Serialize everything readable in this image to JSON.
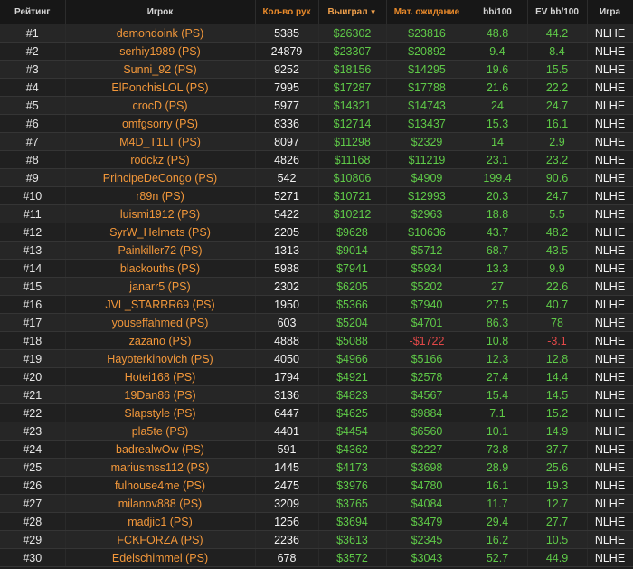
{
  "headers": {
    "rank": "Рейтинг",
    "player": "Игрок",
    "hands": "Кол-во рук",
    "won": "Выиграл",
    "ev": "Мат. ожидание",
    "bb100": "bb/100",
    "evbb100": "EV bb/100",
    "game": "Игра"
  },
  "sort_arrow": "▼",
  "colors": {
    "accent": "#f2973a",
    "positive": "#5fca48",
    "negative": "#e24848",
    "background": "#1e1e1e"
  },
  "rows": [
    {
      "rank": "#1",
      "player": "demondoink (PS)",
      "hands": "5385",
      "won": "$26302",
      "ev": "$23816",
      "bb100": "48.8",
      "evbb100": "44.2",
      "game": "NLHE"
    },
    {
      "rank": "#2",
      "player": "serhiy1989 (PS)",
      "hands": "24879",
      "won": "$23307",
      "ev": "$20892",
      "bb100": "9.4",
      "evbb100": "8.4",
      "game": "NLHE"
    },
    {
      "rank": "#3",
      "player": "Sunni_92 (PS)",
      "hands": "9252",
      "won": "$18156",
      "ev": "$14295",
      "bb100": "19.6",
      "evbb100": "15.5",
      "game": "NLHE"
    },
    {
      "rank": "#4",
      "player": "ElPonchisLOL (PS)",
      "hands": "7995",
      "won": "$17287",
      "ev": "$17788",
      "bb100": "21.6",
      "evbb100": "22.2",
      "game": "NLHE"
    },
    {
      "rank": "#5",
      "player": "crocD (PS)",
      "hands": "5977",
      "won": "$14321",
      "ev": "$14743",
      "bb100": "24",
      "evbb100": "24.7",
      "game": "NLHE"
    },
    {
      "rank": "#6",
      "player": "omfgsorry (PS)",
      "hands": "8336",
      "won": "$12714",
      "ev": "$13437",
      "bb100": "15.3",
      "evbb100": "16.1",
      "game": "NLHE"
    },
    {
      "rank": "#7",
      "player": "M4D_T1LT (PS)",
      "hands": "8097",
      "won": "$11298",
      "ev": "$2329",
      "bb100": "14",
      "evbb100": "2.9",
      "game": "NLHE"
    },
    {
      "rank": "#8",
      "player": "rodckz (PS)",
      "hands": "4826",
      "won": "$11168",
      "ev": "$11219",
      "bb100": "23.1",
      "evbb100": "23.2",
      "game": "NLHE"
    },
    {
      "rank": "#9",
      "player": "PrincipeDeCongo (PS)",
      "hands": "542",
      "won": "$10806",
      "ev": "$4909",
      "bb100": "199.4",
      "evbb100": "90.6",
      "game": "NLHE"
    },
    {
      "rank": "#10",
      "player": "r89n (PS)",
      "hands": "5271",
      "won": "$10721",
      "ev": "$12993",
      "bb100": "20.3",
      "evbb100": "24.7",
      "game": "NLHE"
    },
    {
      "rank": "#11",
      "player": "luismi1912 (PS)",
      "hands": "5422",
      "won": "$10212",
      "ev": "$2963",
      "bb100": "18.8",
      "evbb100": "5.5",
      "game": "NLHE"
    },
    {
      "rank": "#12",
      "player": "SyrW_Helmets (PS)",
      "hands": "2205",
      "won": "$9628",
      "ev": "$10636",
      "bb100": "43.7",
      "evbb100": "48.2",
      "game": "NLHE"
    },
    {
      "rank": "#13",
      "player": "Painkiller72 (PS)",
      "hands": "1313",
      "won": "$9014",
      "ev": "$5712",
      "bb100": "68.7",
      "evbb100": "43.5",
      "game": "NLHE"
    },
    {
      "rank": "#14",
      "player": "blackouths (PS)",
      "hands": "5988",
      "won": "$7941",
      "ev": "$5934",
      "bb100": "13.3",
      "evbb100": "9.9",
      "game": "NLHE"
    },
    {
      "rank": "#15",
      "player": "janarr5 (PS)",
      "hands": "2302",
      "won": "$6205",
      "ev": "$5202",
      "bb100": "27",
      "evbb100": "22.6",
      "game": "NLHE"
    },
    {
      "rank": "#16",
      "player": "JVL_STARRR69 (PS)",
      "hands": "1950",
      "won": "$5366",
      "ev": "$7940",
      "bb100": "27.5",
      "evbb100": "40.7",
      "game": "NLHE"
    },
    {
      "rank": "#17",
      "player": "youseffahmed (PS)",
      "hands": "603",
      "won": "$5204",
      "ev": "$4701",
      "bb100": "86.3",
      "evbb100": "78",
      "game": "NLHE"
    },
    {
      "rank": "#18",
      "player": "zazano (PS)",
      "hands": "4888",
      "won": "$5088",
      "ev": "-$1722",
      "bb100": "10.8",
      "evbb100": "-3.1",
      "game": "NLHE"
    },
    {
      "rank": "#19",
      "player": "Hayoterkinovich (PS)",
      "hands": "4050",
      "won": "$4966",
      "ev": "$5166",
      "bb100": "12.3",
      "evbb100": "12.8",
      "game": "NLHE"
    },
    {
      "rank": "#20",
      "player": "Hotei168 (PS)",
      "hands": "1794",
      "won": "$4921",
      "ev": "$2578",
      "bb100": "27.4",
      "evbb100": "14.4",
      "game": "NLHE"
    },
    {
      "rank": "#21",
      "player": "19Dan86 (PS)",
      "hands": "3136",
      "won": "$4823",
      "ev": "$4567",
      "bb100": "15.4",
      "evbb100": "14.5",
      "game": "NLHE"
    },
    {
      "rank": "#22",
      "player": "Slapstyle (PS)",
      "hands": "6447",
      "won": "$4625",
      "ev": "$9884",
      "bb100": "7.1",
      "evbb100": "15.2",
      "game": "NLHE"
    },
    {
      "rank": "#23",
      "player": "pla5te (PS)",
      "hands": "4401",
      "won": "$4454",
      "ev": "$6560",
      "bb100": "10.1",
      "evbb100": "14.9",
      "game": "NLHE"
    },
    {
      "rank": "#24",
      "player": "badrealwOw (PS)",
      "hands": "591",
      "won": "$4362",
      "ev": "$2227",
      "bb100": "73.8",
      "evbb100": "37.7",
      "game": "NLHE"
    },
    {
      "rank": "#25",
      "player": "mariusmss112 (PS)",
      "hands": "1445",
      "won": "$4173",
      "ev": "$3698",
      "bb100": "28.9",
      "evbb100": "25.6",
      "game": "NLHE"
    },
    {
      "rank": "#26",
      "player": "fulhouse4me (PS)",
      "hands": "2475",
      "won": "$3976",
      "ev": "$4780",
      "bb100": "16.1",
      "evbb100": "19.3",
      "game": "NLHE"
    },
    {
      "rank": "#27",
      "player": "milanov888 (PS)",
      "hands": "3209",
      "won": "$3765",
      "ev": "$4084",
      "bb100": "11.7",
      "evbb100": "12.7",
      "game": "NLHE"
    },
    {
      "rank": "#28",
      "player": "madjic1 (PS)",
      "hands": "1256",
      "won": "$3694",
      "ev": "$3479",
      "bb100": "29.4",
      "evbb100": "27.7",
      "game": "NLHE"
    },
    {
      "rank": "#29",
      "player": "FCKFORZA (PS)",
      "hands": "2236",
      "won": "$3613",
      "ev": "$2345",
      "bb100": "16.2",
      "evbb100": "10.5",
      "game": "NLHE"
    },
    {
      "rank": "#30",
      "player": "Edelschimmel (PS)",
      "hands": "678",
      "won": "$3572",
      "ev": "$3043",
      "bb100": "52.7",
      "evbb100": "44.9",
      "game": "NLHE"
    }
  ]
}
